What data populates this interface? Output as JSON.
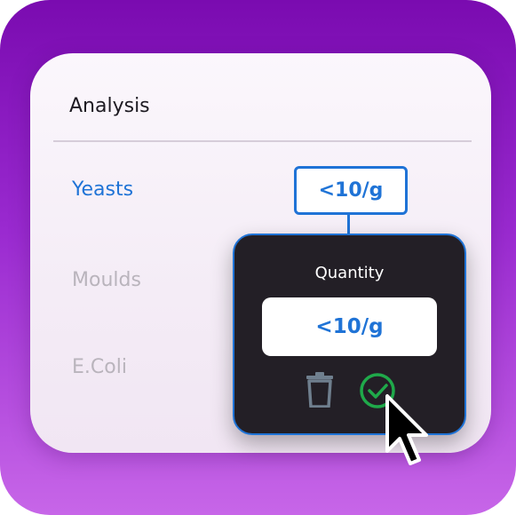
{
  "card": {
    "title": "Analysis",
    "rows": [
      {
        "label": "Yeasts"
      },
      {
        "label": "Moulds"
      },
      {
        "label": "E.Coli"
      }
    ]
  },
  "selected_value": "<10/g",
  "popover": {
    "label": "Quantity",
    "input_value": "<10/g",
    "delete_icon": "trash-icon",
    "confirm_icon": "check-circle-icon"
  },
  "colors": {
    "accent": "#1f73d6",
    "confirm": "#1fa94a",
    "popover_bg": "#231f26",
    "frame_top": "#7a0bb0",
    "frame_bottom": "#c766e8"
  }
}
